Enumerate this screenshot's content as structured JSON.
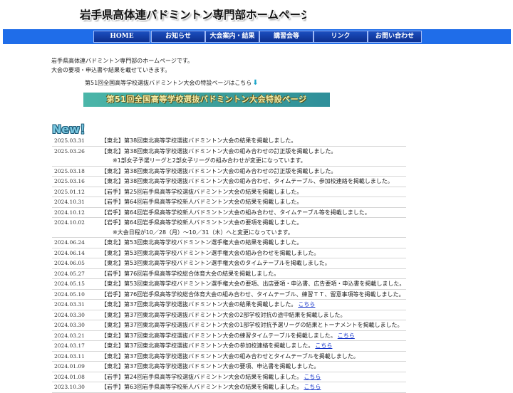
{
  "site": {
    "title": "岩手県高体連バドミントン専門部ホームページ"
  },
  "nav": [
    {
      "label": "HOME"
    },
    {
      "label": "お知らせ"
    },
    {
      "label": "大会案内・結果"
    },
    {
      "label": "講習会等"
    },
    {
      "label": "リンク"
    },
    {
      "label": "お問い合わせ"
    }
  ],
  "intro": {
    "line1": "岩手県高体連バドミントン専門部のホームページです。",
    "line2": "大会の要項・申込書や結果を載せていきます。"
  },
  "special": {
    "text": "第51回全国高等学校選抜バドミントン大会の特設ページはこちら",
    "arrow_icon": "down-arrow-icon",
    "banner": "第51回全国高等学校選抜バドミントン大会特設ページ"
  },
  "new_label": "New！",
  "news": [
    {
      "date": "2025.03.31",
      "text": "【東北】第38回東北高等学校選抜バドミントン大会の結果を掲載しました。"
    },
    {
      "date": "2025.03.26",
      "text": "【東北】第38回東北高等学校選抜バドミントン大会の組み合わせの訂正版を掲載しました。",
      "note": "※1部女子予選リーグと2部女子リーグの組み合わせが変更になっています。"
    },
    {
      "date": "2025.03.18",
      "text": "【東北】第38回東北高等学校選抜バドミントン大会の組み合わせの訂正版を掲載しました。"
    },
    {
      "date": "2025.03.16",
      "text": "【東北】第38回東北高等学校選抜バドミントン大会の組み合わせ、タイムテーブル、参加校連絡を掲載しました。"
    },
    {
      "date": "2025.01.12",
      "text": "【岩手】第25回岩手県高等学校選抜バドミントン大会の結果を掲載しました。"
    },
    {
      "date": "2024.10.31",
      "text": "【岩手】第64回岩手県高等学校新人バドミントン大会の結果を掲載しました。"
    },
    {
      "date": "2024.10.12",
      "text": "【岩手】第64回岩手県高等学校新人バドミントン大会の組み合わせ、タイムテーブル等を掲載しました。"
    },
    {
      "date": "2024.10.02",
      "text": "【岩手】第64回岩手県高等学校新人バドミントン大会の要項を掲載しました。",
      "note": "※大会日程が10／28（月）〜10／31（木）へと変更になっています。"
    },
    {
      "date": "2024.06.24",
      "text": "【東北】第53回東北高等学校バドミントン選手権大会の結果を掲載しました。"
    },
    {
      "date": "2024.06.14",
      "text": "【東北】第53回東北高等学校バドミントン選手権大会の組み合わせを掲載しました。"
    },
    {
      "date": "2024.06.05",
      "text": "【東北】第53回東北高等学校バドミントン選手権大会のタイムテーブルを掲載しました。"
    },
    {
      "date": "2024.05.27",
      "text": "【岩手】第76回岩手県高等学校総合体育大会の結果を掲載しました。"
    },
    {
      "date": "2024.05.15",
      "text": "【東北】第53回東北高等学校バドミントン選手権大会の要項、出店要項・申込書、広告要項・申込書を掲載しました。"
    },
    {
      "date": "2024.05.10",
      "text": "【岩手】第76回岩手県高等学校総合体育大会の組み合わせ、タイムテーブル、練習ＴＴ、留意事項等を掲載しました。"
    },
    {
      "date": "2024.03.31",
      "text": "【東北】第37回東北高等学校選抜バドミントン大会の結果を掲載しました。",
      "link": "こちら"
    },
    {
      "date": "2024.03.30",
      "text": "【東北】第37回東北高等学校選抜バドミントン大会の2部学校対抗の途中結果を掲載しました。"
    },
    {
      "date": "2024.03.30",
      "text": "【東北】第37回東北高等学校選抜バドミントン大会の1部学校対抗予選リーグの結果とトーナメントを掲載しました。"
    },
    {
      "date": "2024.03.21",
      "text": "【東北】第37回東北高等学校選抜バドミントン大会の練習タイムテーブルを掲載しました。",
      "link": "こちら"
    },
    {
      "date": "2024.03.17",
      "text": "【東北】第37回東北高等学校選抜バドミントン大会の参加校連絡を掲載しました。",
      "link": "こちら"
    },
    {
      "date": "2024.03.11",
      "text": "【東北】第37回東北高等学校選抜バドミントン大会の組み合わせとタイムテーブルを掲載しました。"
    },
    {
      "date": "2024.01.09",
      "text": "【東北】第37回東北高等学校選抜バドミントン大会の要項、申込書を掲載しました。"
    },
    {
      "date": "2024.01.08",
      "text": "【岩手】第24回岩手県高等学校選抜バドミントン大会の結果を掲載しました。",
      "link": "こちら"
    },
    {
      "date": "2023.10.30",
      "text": "【岩手】第63回岩手県高等学校新人バドミントン大会の結果を掲載しました。",
      "link": "こちら"
    }
  ]
}
